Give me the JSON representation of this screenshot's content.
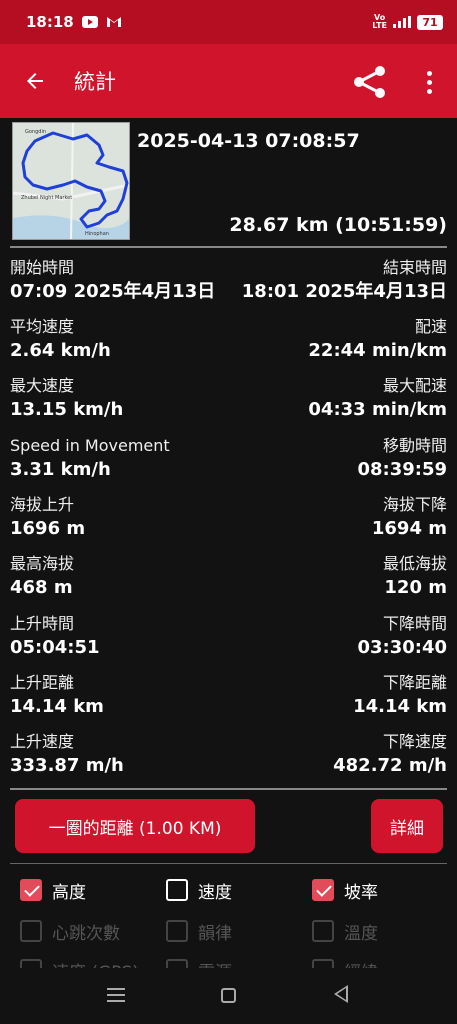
{
  "status_bar": {
    "time": "18:18",
    "carrier_label": "Vo\nLTE",
    "battery": "71",
    "icons": [
      "youtube-icon",
      "gmail-icon",
      "volte-icon",
      "signal-icon",
      "battery-icon"
    ]
  },
  "app_bar": {
    "title": "統計",
    "icons": [
      "back-arrow-icon",
      "share-icon",
      "more-vert-icon"
    ]
  },
  "track": {
    "date": "2025-04-13 07:08:57",
    "summary": "28.67 km (10:51:59)",
    "map_labels": [
      "Gongdin",
      "Zhubei Night Market",
      "Hinophan"
    ]
  },
  "stats": [
    {
      "left_label": "開始時間",
      "left_value": "07:09 2025年4月13日",
      "right_label": "結束時間",
      "right_value": "18:01 2025年4月13日"
    },
    {
      "left_label": "平均速度",
      "left_value": "2.64 km/h",
      "right_label": "配速",
      "right_value": "22:44 min/km"
    },
    {
      "left_label": "最大速度",
      "left_value": "13.15 km/h",
      "right_label": "最大配速",
      "right_value": "04:33 min/km"
    },
    {
      "left_label": "Speed in Movement",
      "left_value": "3.31 km/h",
      "right_label": "移動時間",
      "right_value": "08:39:59"
    },
    {
      "left_label": "海拔上升",
      "left_value": "1696 m",
      "right_label": "海拔下降",
      "right_value": "1694 m"
    },
    {
      "left_label": "最高海拔",
      "left_value": "468 m",
      "right_label": "最低海拔",
      "right_value": "120 m"
    },
    {
      "left_label": "上升時間",
      "left_value": "05:04:51",
      "right_label": "下降時間",
      "right_value": "03:30:40"
    },
    {
      "left_label": "上升距離",
      "left_value": "14.14 km",
      "right_label": "下降距離",
      "right_value": "14.14 km"
    },
    {
      "left_label": "上升速度",
      "left_value": "333.87 m/h",
      "right_label": "下降速度",
      "right_value": "482.72 m/h"
    }
  ],
  "buttons": {
    "lap": "一圈的距離 (1.00  KM)",
    "detail": "詳細"
  },
  "options": [
    {
      "label": "高度",
      "checked": true,
      "enabled": true
    },
    {
      "label": "速度",
      "checked": false,
      "enabled": true
    },
    {
      "label": "坡率",
      "checked": true,
      "enabled": true
    },
    {
      "label": "心跳次數",
      "checked": false,
      "enabled": false
    },
    {
      "label": "韻律",
      "checked": false,
      "enabled": false
    },
    {
      "label": "溫度",
      "checked": false,
      "enabled": false
    },
    {
      "label": "速度 (GPS)",
      "checked": false,
      "enabled": false
    },
    {
      "label": "電源",
      "checked": false,
      "enabled": false
    },
    {
      "label": "經緯",
      "checked": false,
      "enabled": false
    }
  ],
  "colors": {
    "status_bar": "#b50e22",
    "app_bar": "#d0142c",
    "accent": "#e24b5a",
    "background": "#121212"
  }
}
